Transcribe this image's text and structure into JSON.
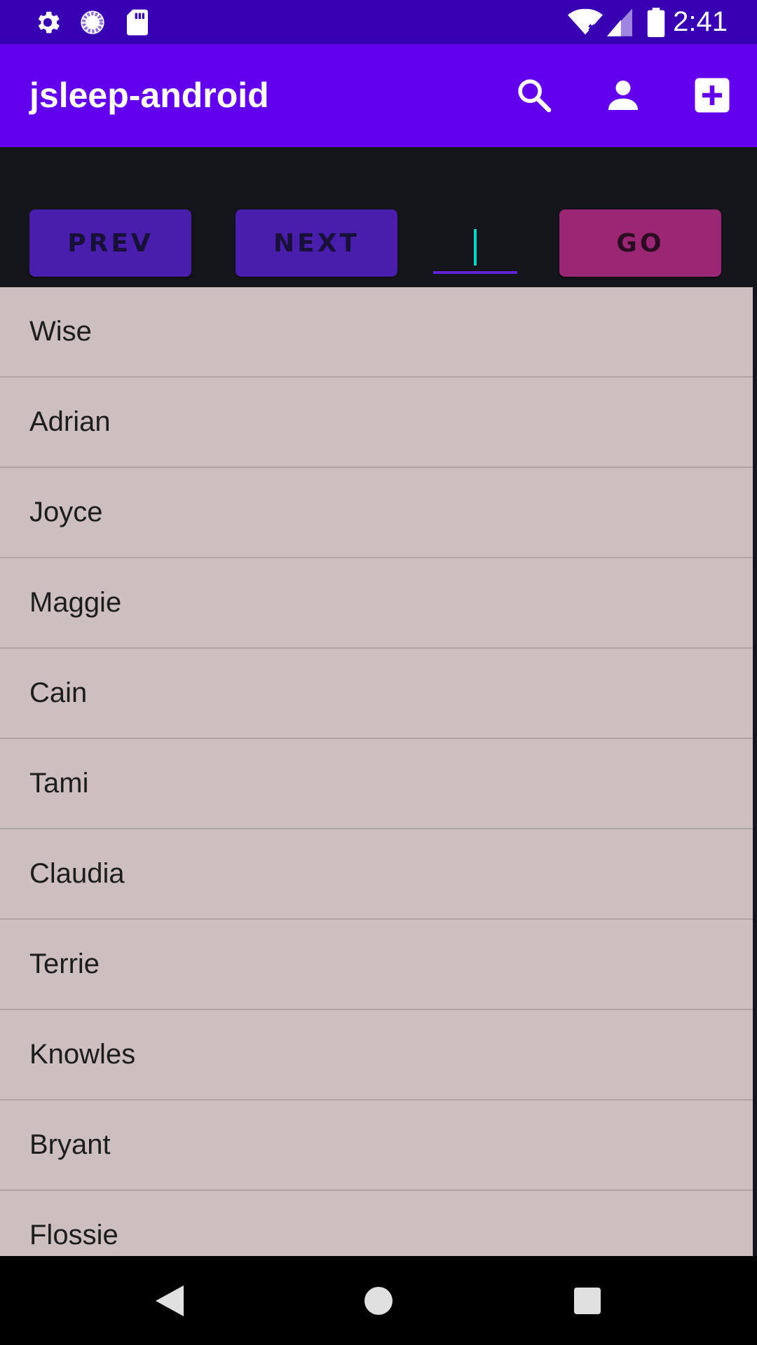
{
  "status_bar": {
    "time": "2:41",
    "icons": [
      "gear-icon",
      "sync-circle-icon",
      "sd-card-icon",
      "wifi-icon",
      "signal-icon",
      "battery-icon"
    ]
  },
  "app_bar": {
    "title": "jsleep-android",
    "actions": [
      "search-icon",
      "person-icon",
      "add-box-icon"
    ]
  },
  "controls": {
    "prev_label": "PREV",
    "next_label": "NEXT",
    "go_label": "GO",
    "page_value": ""
  },
  "list": {
    "items": [
      "Wise",
      "Adrian",
      "Joyce",
      "Maggie",
      "Cain",
      "Tami",
      "Claudia",
      "Terrie",
      "Knowles",
      "Bryant",
      "Flossie"
    ]
  },
  "nav_bar": {
    "buttons": [
      "back-icon",
      "home-icon",
      "recents-icon"
    ]
  },
  "colors": {
    "status_bar": "#3700b3",
    "app_bar": "#6200ee",
    "background": "#15151c",
    "button_primary": "#4a1ead",
    "button_go": "#9b2673",
    "list_bg": "#cdbfbf",
    "caret": "#03dac5"
  }
}
